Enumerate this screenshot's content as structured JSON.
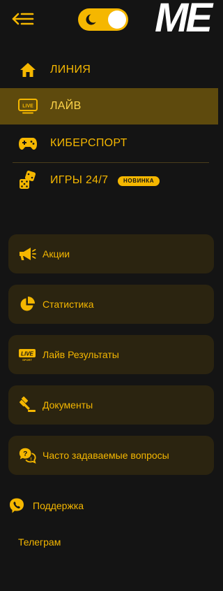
{
  "header": {
    "back_icon": "menu-collapse-arrow-icon",
    "theme_toggle": {
      "state": "on",
      "icon": "sun-icon"
    },
    "logo_text": "ME"
  },
  "nav": [
    {
      "label": "ЛИНИЯ",
      "icon": "home-icon",
      "active": false
    },
    {
      "label": "ЛАЙВ",
      "icon": "live-tv-icon",
      "active": true,
      "icon_text": "LIVE"
    },
    {
      "label": "КИБЕРСПОРТ",
      "icon": "gamepad-icon",
      "active": false
    },
    {
      "label": "ИГРЫ 24/7",
      "icon": "dice-icon",
      "active": false,
      "badge": "НОВИНКА"
    }
  ],
  "cards": [
    {
      "label": "Акции",
      "icon": "megaphone-icon"
    },
    {
      "label": "Статистика",
      "icon": "pie-chart-icon"
    },
    {
      "label": "Лайв Результаты",
      "icon": "live-results-icon",
      "icon_text": "LIVE",
      "icon_subtext": "SPORT"
    },
    {
      "label": "Документы",
      "icon": "gavel-icon"
    },
    {
      "label": "Часто задаваемые вопросы",
      "icon": "faq-chat-icon"
    }
  ],
  "support": {
    "label": "Поддержка",
    "icon": "viber-phone-icon"
  },
  "telegram": {
    "label": "Телеграм"
  },
  "colors": {
    "accent": "#f5b700",
    "background": "#141414",
    "active_bg": "#5e4a0d",
    "card_bg": "#2b2410"
  }
}
